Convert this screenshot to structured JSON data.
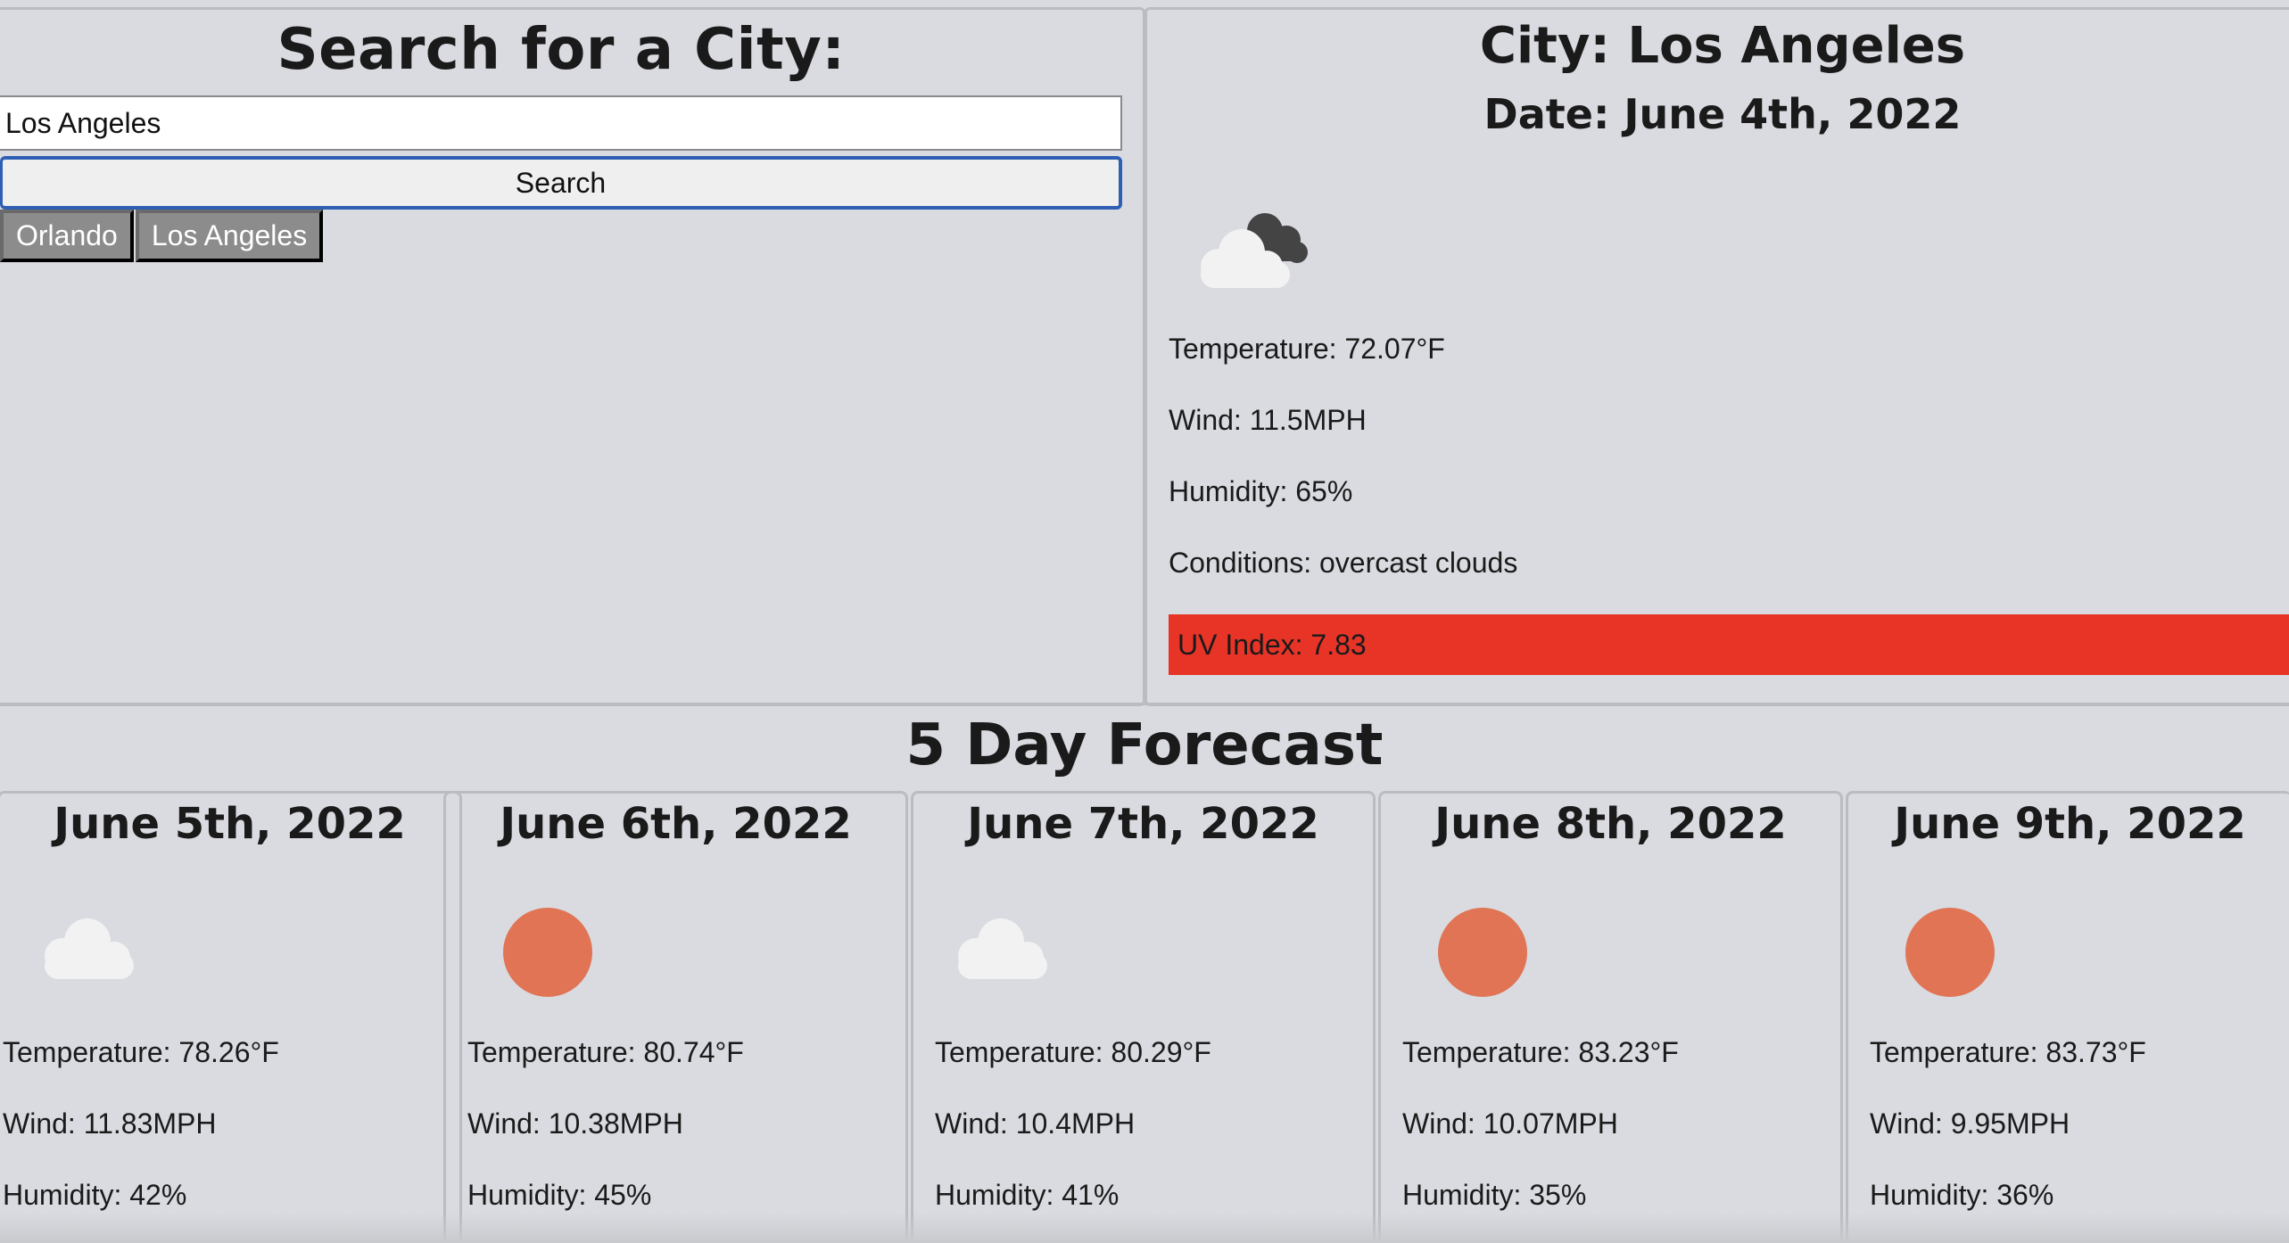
{
  "search": {
    "title": "Search for a City:",
    "input_value": "Los Angeles",
    "button_label": "Search",
    "history": [
      "Orlando",
      "Los Angeles"
    ]
  },
  "current": {
    "city": "City: Los Angeles",
    "date": "Date: June 4th, 2022",
    "icon": "overcast-clouds-icon",
    "temperature": "Temperature: 72.07°F",
    "wind": "Wind: 11.5MPH",
    "humidity": "Humidity: 65%",
    "conditions": "Conditions: overcast clouds",
    "uv_index": "UV Index: 7.83",
    "uv_color": "#e83427"
  },
  "forecast": {
    "title": "5 Day Forecast",
    "days": [
      {
        "date": "June 5th, 2022",
        "icon": "cloud-icon",
        "temperature": "Temperature: 78.26°F",
        "wind": "Wind: 11.83MPH",
        "humidity": "Humidity: 42%"
      },
      {
        "date": "June 6th, 2022",
        "icon": "sun-icon",
        "temperature": "Temperature: 80.74°F",
        "wind": "Wind: 10.38MPH",
        "humidity": "Humidity: 45%"
      },
      {
        "date": "June 7th, 2022",
        "icon": "cloud-icon",
        "temperature": "Temperature: 80.29°F",
        "wind": "Wind: 10.4MPH",
        "humidity": "Humidity: 41%"
      },
      {
        "date": "June 8th, 2022",
        "icon": "sun-icon",
        "temperature": "Temperature: 83.23°F",
        "wind": "Wind: 10.07MPH",
        "humidity": "Humidity: 35%"
      },
      {
        "date": "June 9th, 2022",
        "icon": "sun-icon",
        "temperature": "Temperature: 83.73°F",
        "wind": "Wind: 9.95MPH",
        "humidity": "Humidity: 36%"
      }
    ]
  },
  "colors": {
    "background": "#d9dbe0",
    "sun": "#e07455",
    "cloud": "#f2f2f2",
    "dark_cloud": "#444444"
  }
}
